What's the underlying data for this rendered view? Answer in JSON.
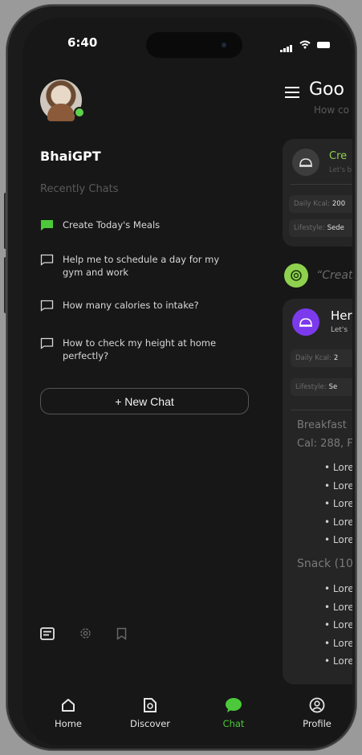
{
  "status_bar": {
    "time": "6:40"
  },
  "user": {
    "name": "BhaiGPT"
  },
  "sidebar": {
    "section_title": "Recently Chats",
    "chats": [
      {
        "label": "Create Today's Meals",
        "active": true
      },
      {
        "label": "Help me to schedule a day for my gym and work",
        "active": false
      },
      {
        "label": "How many calories to intake?",
        "active": false
      },
      {
        "label": "How to check my height at home perfectly?",
        "active": false
      }
    ],
    "new_chat_label": "+ New Chat"
  },
  "main": {
    "greeting": "Goo",
    "greeting_sub": "How co",
    "card1": {
      "title": "Cre",
      "subtitle": "Let's b",
      "kcal_label": "Daily Kcal:",
      "kcal_value": "200",
      "lifestyle_label": "Lifestyle:",
      "lifestyle_value": "Sede"
    },
    "prompt": "“Creat",
    "card2": {
      "title": "Her",
      "subtitle": "Let's",
      "kcal_label": "Daily Kcal:",
      "kcal_value": "2",
      "lifestyle_label": "Lifestyle:",
      "lifestyle_value": "Se",
      "breakfast_title": "Breakfast",
      "breakfast_cal": "Cal: 288, F",
      "breakfast_items": [
        "Lore",
        "Lore",
        "Lore",
        "Lore",
        "Lore"
      ],
      "snack_title": "Snack (10",
      "snack_items": [
        "Lore",
        "Lore",
        "Lore",
        "Lore",
        "Lore"
      ]
    }
  },
  "nav": [
    {
      "label": "Home",
      "icon": "home-icon",
      "active": false
    },
    {
      "label": "Discover",
      "icon": "discover-icon",
      "active": false
    },
    {
      "label": "Chat",
      "icon": "chat-icon",
      "active": true
    },
    {
      "label": "Profile",
      "icon": "profile-icon",
      "active": false
    }
  ],
  "colors": {
    "accent": "#4cc93a",
    "background": "#171717",
    "card": "#252525",
    "purple": "#7c3aed",
    "prompt_icon": "#8fd14f"
  }
}
